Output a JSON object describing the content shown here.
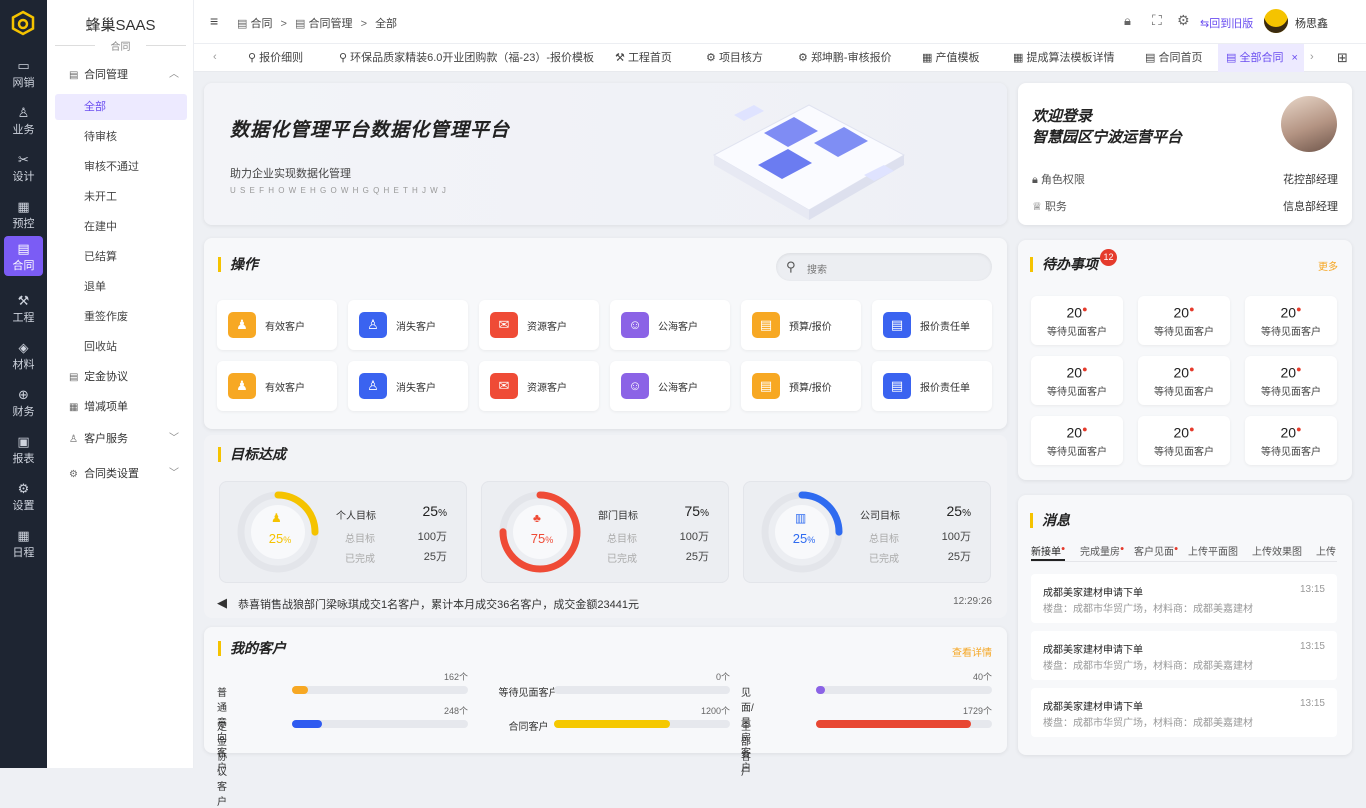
{
  "rail": [
    {
      "label": "网销",
      "icon": "screen-icon"
    },
    {
      "label": "业务",
      "icon": "person-icon"
    },
    {
      "label": "设计",
      "icon": "tools-icon"
    },
    {
      "label": "预控",
      "icon": "grid-icon"
    },
    {
      "label": "合同",
      "icon": "contract-icon"
    },
    {
      "label": "工程",
      "icon": "hammer-icon"
    },
    {
      "label": "材料",
      "icon": "brick-icon"
    },
    {
      "label": "财务",
      "icon": "money-icon"
    },
    {
      "label": "报表",
      "icon": "report-icon"
    },
    {
      "label": "设置",
      "icon": "gear-icon"
    },
    {
      "label": "日程",
      "icon": "calendar-icon"
    }
  ],
  "brand": {
    "name": "蜂巢SAAS",
    "sub": "合同"
  },
  "menu": {
    "group1": "合同管理",
    "items": [
      "全部",
      "待审核",
      "审核不通过",
      "未开工",
      "在建中",
      "已结算",
      "退单",
      "重签作废",
      "回收站"
    ],
    "group2": "定金协议",
    "group3": "增减项单",
    "group4": "客户服务",
    "group5": "合同类设置"
  },
  "breadcrumb": {
    "a": "合同",
    "b": "合同管理",
    "c": "全部"
  },
  "topbar": {
    "back": "回到旧版",
    "user": "杨思鑫"
  },
  "tabs": [
    "报价细则",
    "环保品质家精装6.0开业团购款（福-23）-报价模板",
    "工程首页",
    "项目核方",
    "郑坤鹏-审核报价",
    "产值模板",
    "提成算法模板详情",
    "合同首页",
    "全部合同"
  ],
  "banner": {
    "title": "数据化管理平台数据化管理平台",
    "sub": "助力企业实现数据化管理",
    "letters": "U S E F H O W E H G O W H G Q H E T H J W J"
  },
  "profile": {
    "l1": "欢迎登录",
    "l2": "智慧园区宁波运营平台",
    "r1k": "角色权限",
    "r1v": "花控部经理",
    "r2k": "职务",
    "r2v": "信息部经理"
  },
  "ops": {
    "title": "操作",
    "search": "搜索",
    "row": [
      "有效客户",
      "消失客户",
      "资源客户",
      "公海客户",
      "预算/报价",
      "报价责任单"
    ],
    "colors": [
      "#f7a823",
      "#3a63f0",
      "#ef4b36",
      "#8b63e6",
      "#f7a823",
      "#3a63f0"
    ]
  },
  "goals": {
    "title": "目标达成",
    "total_k": "总目标",
    "done_k": "已完成",
    "items": [
      {
        "name": "个人目标",
        "pct": "25",
        "total": "100万",
        "done": "25万",
        "color": "#f5c300",
        "icon": "person-icon",
        "frac": 0.25
      },
      {
        "name": "部门目标",
        "pct": "75",
        "total": "100万",
        "done": "25万",
        "color": "#ef4b36",
        "icon": "org-icon",
        "frac": 0.75
      },
      {
        "name": "公司目标",
        "pct": "25",
        "total": "100万",
        "done": "25万",
        "color": "#2f6bf0",
        "icon": "building-icon",
        "frac": 0.25
      }
    ]
  },
  "notice": {
    "text": "恭喜销售战狼部门梁咏琪成交1名客户，累计本月成交36名客户，成交金额23441元",
    "time": "12:29:26"
  },
  "customers": {
    "title": "我的客户",
    "more": "查看详情",
    "items": [
      {
        "label": "普通意向客户",
        "num": "162个",
        "color": "#f7a823",
        "frac": 0.09
      },
      {
        "label": "等待见面客户",
        "num": "0个",
        "color": "#f5c300",
        "frac": 0.0
      },
      {
        "label": "见面/量房客户",
        "num": "40个",
        "color": "#8b63e6",
        "frac": 0.04
      },
      {
        "label": "定金协议客户",
        "num": "248个",
        "color": "#2f5bf0",
        "frac": 0.17
      },
      {
        "label": "合同客户",
        "num": "1200个",
        "color": "#f5c800",
        "frac": 0.66
      },
      {
        "label": "全部客户",
        "num": "1729个",
        "color": "#e84732",
        "frac": 0.88
      }
    ]
  },
  "todo": {
    "title": "待办事项",
    "badge": "12",
    "more": "更多",
    "num": "20",
    "label": "等待见面客户"
  },
  "messages": {
    "title": "消息",
    "tabs": [
      "新接单",
      "完成量房",
      "客户见面",
      "上传平面图",
      "上传效果图",
      "上传"
    ],
    "item": {
      "title": "成都美家建材申请下单",
      "time": "13:15",
      "sub": "楼盘：成都市华贸广场，材料商：成都美嘉建材"
    }
  }
}
